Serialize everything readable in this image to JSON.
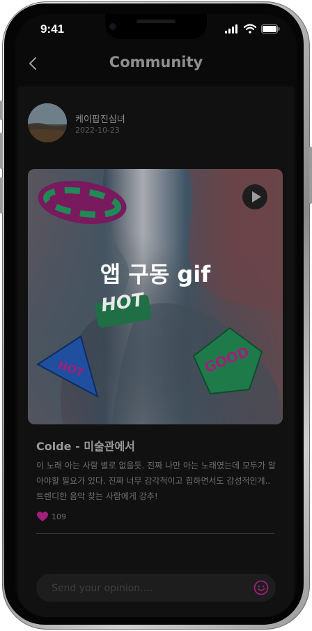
{
  "status_bar": {
    "time": "9:41"
  },
  "header": {
    "title": "Community"
  },
  "post": {
    "author": "케이팝진심녀",
    "date": "2022-10-23",
    "media_caption": "앱 구동 gif",
    "stickers": [
      "HOT",
      "GOOD",
      "HOT"
    ],
    "title": "Colde - 미술관에서",
    "body": "이 노래 아는 사람 별로 없을듯. 진짜 나만 아는 노래였는데 모두가 알아야할 필요가 있다. 진짜 너무 감각적이고 힙하면서도 감성적인게.. 트렌디한 음악 찾는 사람에게 강추!",
    "likes": "109"
  },
  "comment_input": {
    "placeholder": "Send your opinion...."
  },
  "colors": {
    "accent": "#a01f7a",
    "sticker_green": "#1f8a55",
    "sticker_blue": "#1f5fb8",
    "background": "#0a0a0a"
  },
  "icons": {
    "back": "chevron-left-icon",
    "play": "play-icon",
    "like": "heart-icon",
    "emoji": "smiley-icon",
    "signal": "signal-icon",
    "wifi": "wifi-icon",
    "battery": "battery-icon"
  }
}
